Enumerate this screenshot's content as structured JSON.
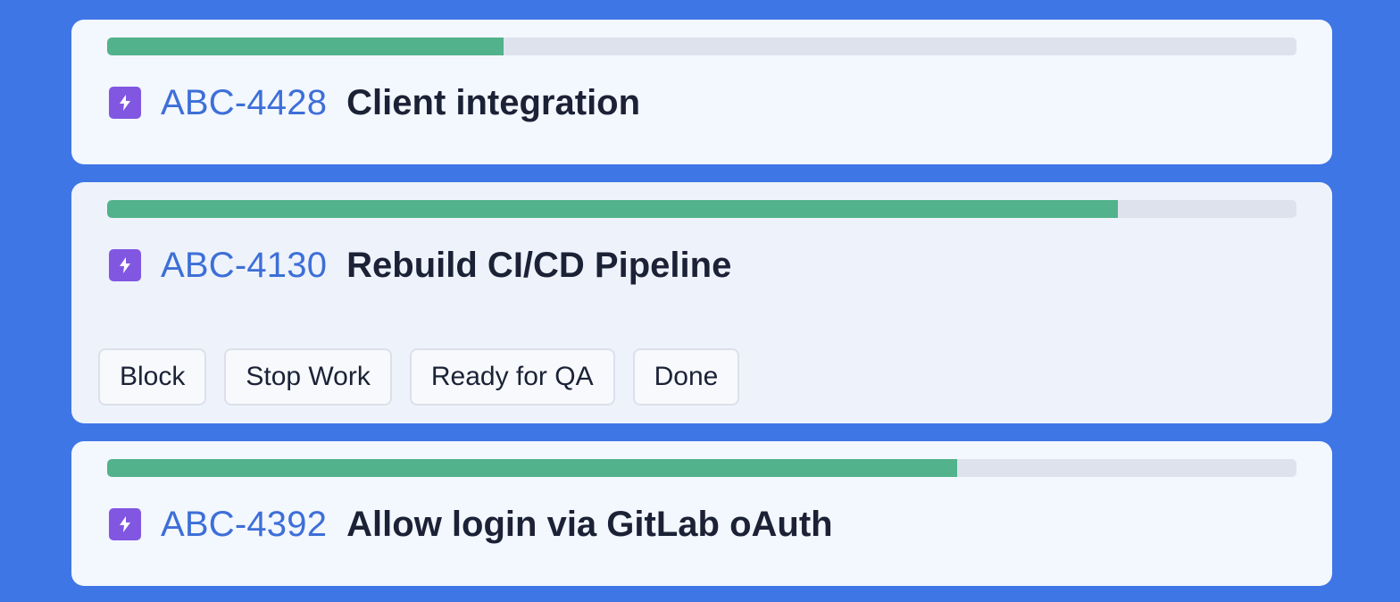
{
  "colors": {
    "background": "#3f76e6",
    "card": "#f3f7fe",
    "progress_fill": "#52b28b",
    "progress_track": "#dde2ec",
    "issue_key": "#3d6fd8",
    "issue_icon": "#8157e2"
  },
  "issues": [
    {
      "icon": "epic-lightning-icon",
      "key": "ABC-4428",
      "title": "Client integration",
      "progress": 0.333
    },
    {
      "icon": "epic-lightning-icon",
      "key": "ABC-4130",
      "title": "Rebuild CI/CD Pipeline",
      "progress": 0.85,
      "actions": [
        "Block",
        "Stop Work",
        "Ready for QA",
        "Done"
      ]
    },
    {
      "icon": "epic-lightning-icon",
      "key": "ABC-4392",
      "title": "Allow login via GitLab oAuth",
      "progress": 0.715
    }
  ]
}
